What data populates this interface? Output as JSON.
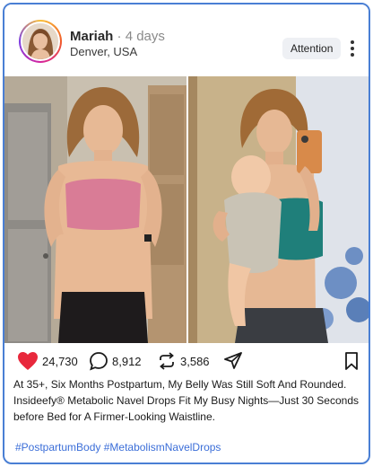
{
  "post": {
    "username": "Mariah",
    "time_sep": " · ",
    "time": "4 days",
    "location": "Denver, USA",
    "attention_label": "Attention",
    "more_icon": "more-vertical-icon",
    "likes": "24,730",
    "comments": "8,912",
    "reposts": "3,586",
    "caption": "At 35+, Six Months Postpartum, My Belly Was Still Soft And Rounded. Insideefy® Metabolic Navel Drops Fit My Busy Nights—Just 30 Seconds before Bed for A Firmer-Looking Waistline.",
    "hashtags": "#PostpartumBody #MetabolismNavelDrops"
  },
  "colors": {
    "heart": "#e8283c",
    "link": "#3b6ed8",
    "card_border": "#4a7fd4"
  }
}
